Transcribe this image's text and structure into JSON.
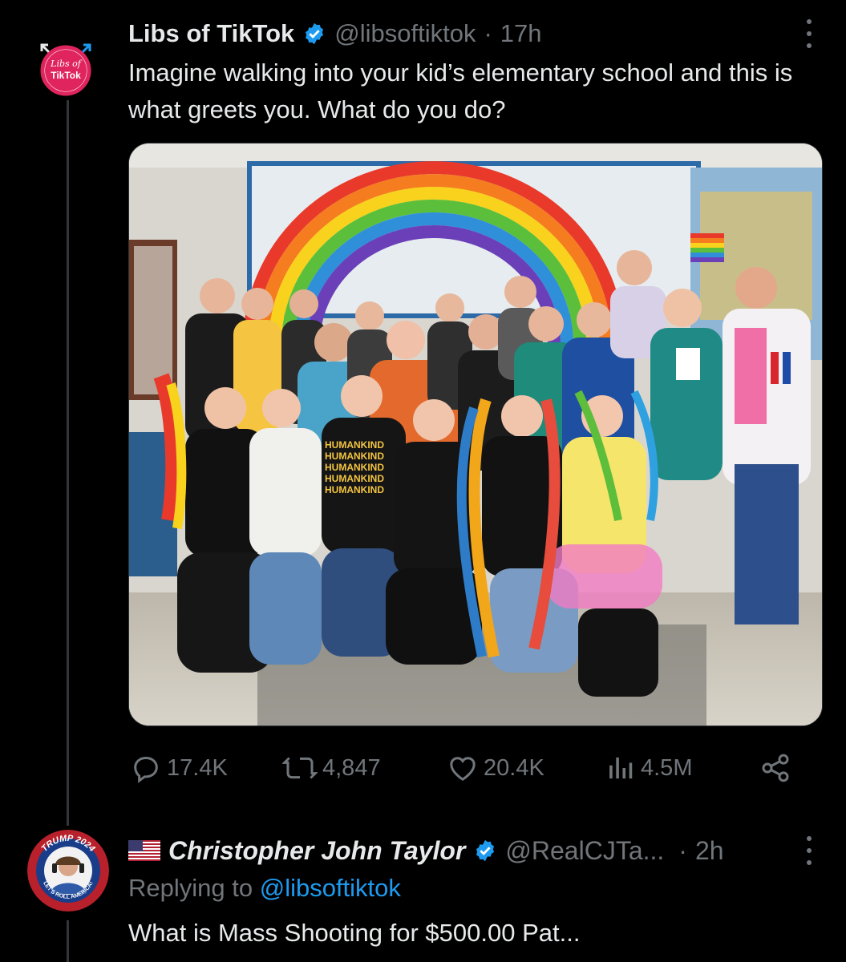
{
  "tweet": {
    "author_name": "Libs of TikTok",
    "author_handle": "@libsoftiktok",
    "separator": "·",
    "time": "17h",
    "avatar_text_line1": "Libs of",
    "avatar_text_line2": "TikTok",
    "text": "Imagine walking into your kid’s elementary school and this is what greets you. What do you do?",
    "image_signs": [
      "HUMANKIND",
      "HUMANKIND",
      "HUMANKIND",
      "HUMANKIND",
      "HUMANKIND"
    ],
    "stats": {
      "replies": "17.4K",
      "retweets": "4,847",
      "likes": "20.4K",
      "views": "4.5M"
    }
  },
  "reply": {
    "author_name": "Christopher John Taylor",
    "author_handle": "@RealCJTa...",
    "separator": "·",
    "time": "2h",
    "avatar_text_top": "TRUMP 2024",
    "avatar_text_bottom": "LET'S ROLL AMERICA!",
    "replying_prefix": "Replying to",
    "replying_to": "@libsoftiktok",
    "text": "What is Mass Shooting for $500.00 Pat..."
  },
  "colors": {
    "background": "#000000",
    "text": "#e7e9ea",
    "muted": "#71767b",
    "accent": "#1d9bf0",
    "verified": "#1d9bf0"
  },
  "icons": [
    "more-icon",
    "verified-icon",
    "reply-icon",
    "retweet-icon",
    "like-icon",
    "views-icon",
    "share-icon",
    "us-flag-icon"
  ]
}
